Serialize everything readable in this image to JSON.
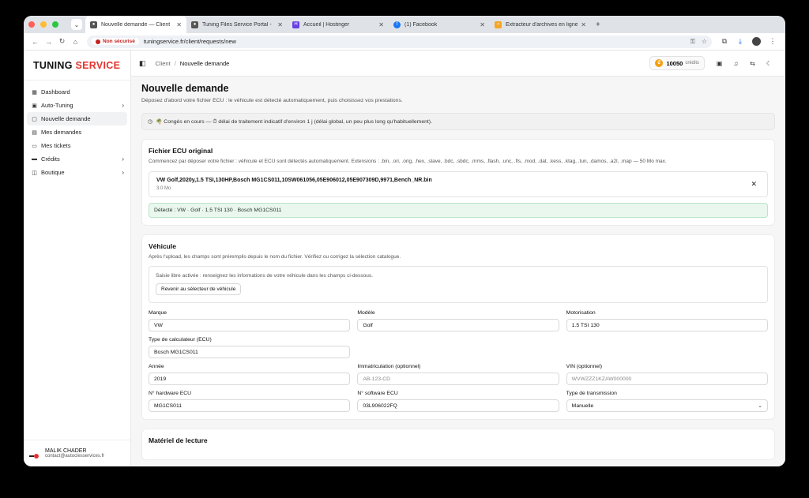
{
  "browser": {
    "tabs": [
      {
        "title": "Nouvelle demande — Client",
        "icon": "paw-icon",
        "active": true
      },
      {
        "title": "Tuning Files Service Portal -",
        "icon": "paw-icon",
        "active": false
      },
      {
        "title": "Accueil | Hostinger",
        "icon": "hostinger-icon",
        "active": false
      },
      {
        "title": "(1) Facebook",
        "icon": "facebook-icon",
        "active": false
      },
      {
        "title": "Extracteur d'archives en ligne",
        "icon": "archive-icon",
        "active": false
      }
    ],
    "insecure_label": "Non sécurisé",
    "url": "tuningservice.fr/client/requests/new"
  },
  "sidebar": {
    "logo_a": "TUNING",
    "logo_b": "SERVICE",
    "items": [
      {
        "label": "Dashboard",
        "icon": "grid-icon",
        "chevron": false
      },
      {
        "label": "Auto-Tuning",
        "icon": "wrench-icon",
        "chevron": true
      },
      {
        "label": "Nouvelle demande",
        "icon": "file-icon",
        "chevron": false,
        "active": true
      },
      {
        "label": "Mes demandes",
        "icon": "document-icon",
        "chevron": false
      },
      {
        "label": "Mes tickets",
        "icon": "ticket-icon",
        "chevron": false
      },
      {
        "label": "Crédits",
        "icon": "card-icon",
        "chevron": true
      },
      {
        "label": "Boutique",
        "icon": "bag-icon",
        "chevron": true
      }
    ],
    "user": {
      "name": "MALIK CHADER",
      "email": "contact@autoclesservices.fr"
    }
  },
  "header": {
    "breadcrumb_root": "Client",
    "breadcrumb_current": "Nouvelle demande",
    "credits_value": "10050",
    "credits_label": "crédits"
  },
  "page": {
    "title": "Nouvelle demande",
    "subtitle": "Déposez d'abord votre fichier ECU : le véhicule est détecté automatiquement, puis choisissez vos prestations.",
    "banner": "🌴 Congés en cours — ⏱ délai de traitement indicatif d'environ 1 j (délai global, un peu plus long qu'habituellement)."
  },
  "ecu_card": {
    "title": "Fichier ECU original",
    "desc": "Commencez par déposer votre fichier : véhicule et ECU sont détectés automatiquement. Extensions : .bin, .ori, .orig, .hex, .slave, .bdc, .sbdc, .mms, .flash, .unc, .fls, .mod, .dat, .kess, .ktag, .tun, .damos, .a2l, .map — 50 Mo max.",
    "file_name": "VW Golf,2020y,1.5 TSI,130HP,Bosch MG1CS011,10SW061056,05E906012,05E907309D,9971,Bench_NR.bin",
    "file_size": "3.0 Mo",
    "detected": "Détecté : VW · Golf · 1.5 TSI 130 · Bosch MG1CS011"
  },
  "vehicle_card": {
    "title": "Véhicule",
    "desc": "Après l'upload, les champs sont préremplis depuis le nom du fichier. Vérifiez ou corrigez la sélection catalogue.",
    "free_text": "Saisie libre activée : renseignez les informations de votre véhicule dans les champs ci-dessous.",
    "back_button": "Revenir au sélecteur de véhicule",
    "fields": {
      "marque": {
        "label": "Marque",
        "value": "VW"
      },
      "modele": {
        "label": "Modèle",
        "value": "Golf"
      },
      "motorisation": {
        "label": "Motorisation",
        "value": "1.5 TSI 130"
      },
      "ecu_type": {
        "label": "Type de calculateur (ECU)",
        "value": "Bosch MG1CS011"
      },
      "annee": {
        "label": "Année",
        "value": "2019"
      },
      "immat": {
        "label": "Immatriculation (optionnel)",
        "placeholder": "AB-123-CD"
      },
      "vin": {
        "label": "VIN (optionnel)",
        "placeholder": "WVWZZZ1KZAW000000"
      },
      "hw": {
        "label": "N° hardware ECU",
        "value": "MG1CS011"
      },
      "sw": {
        "label": "N° software ECU",
        "value": "03L906022FQ"
      },
      "transmission": {
        "label": "Type de transmission",
        "value": "Manuelle"
      }
    }
  },
  "next_card": {
    "title": "Matériel de lecture"
  }
}
